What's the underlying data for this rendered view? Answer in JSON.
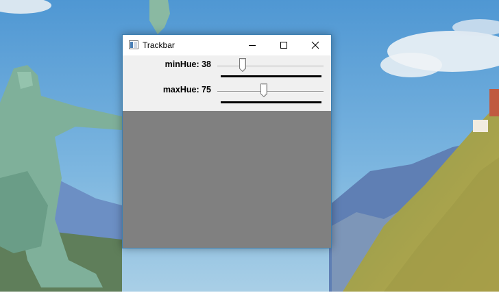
{
  "window": {
    "title": "Trackbar",
    "controls": [
      "minimize",
      "maximize",
      "close"
    ]
  },
  "trackbars": [
    {
      "label": "minHue: 38",
      "value": 38,
      "max": 179
    },
    {
      "label": "maxHue: 75",
      "value": 75,
      "max": 179
    }
  ],
  "colors": {
    "window_border": "#3c7fb1",
    "image_area": "#808080",
    "panel_bg": "#f0f0f0"
  }
}
